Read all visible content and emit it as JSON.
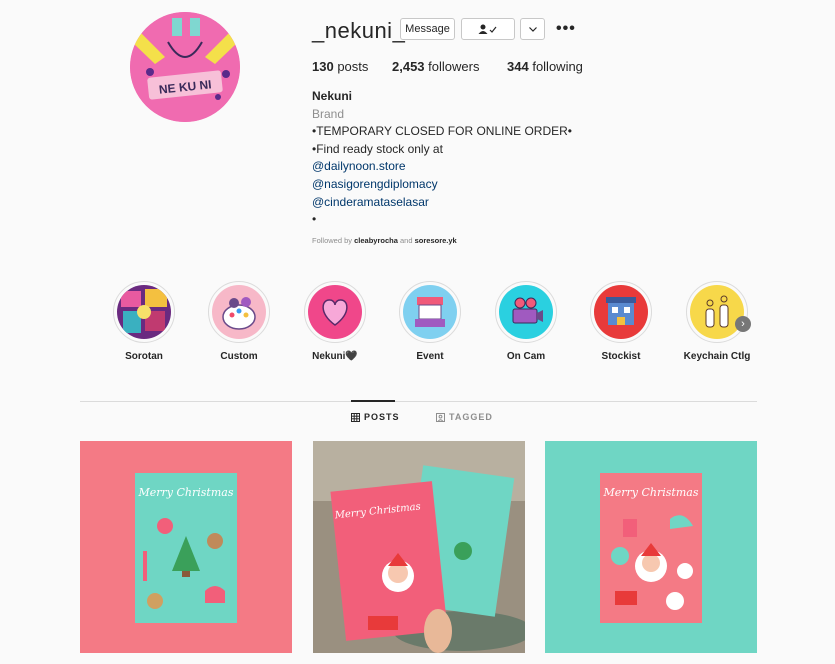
{
  "profile": {
    "username": "_nekuni_",
    "avatar_text": "NE KU NI",
    "buttons": {
      "message": "Message",
      "follow_icon": "person-check-icon",
      "dropdown_icon": "chevron-down-icon",
      "more": "•••"
    },
    "stats": {
      "posts_count": "130",
      "posts_label": "posts",
      "followers_count": "2,453",
      "followers_label": "followers",
      "following_count": "344",
      "following_label": "following"
    },
    "bio": {
      "name": "Nekuni",
      "category": "Brand",
      "lines": [
        "•TEMPORARY CLOSED FOR ONLINE ORDER•",
        "•Find ready stock only at"
      ],
      "mentions": [
        "@dailynoon.store",
        "@nasigorengdiplomacy",
        "@cinderamataselasar"
      ],
      "last_line": "•"
    },
    "followed_by": {
      "prefix": "Followed by",
      "user1": "cleabyrocha",
      "joiner": "and",
      "user2": "soresore.yk"
    }
  },
  "highlights": [
    {
      "label": "Sorotan",
      "icon": "collage-icon",
      "color": "#8a3aa0"
    },
    {
      "label": "Custom",
      "icon": "artist-palette-icon",
      "color": "#f7b8c8"
    },
    {
      "label": "Nekuni🖤",
      "icon": "heart-icon",
      "color": "#f0478a"
    },
    {
      "label": "Event",
      "icon": "booth-stall-icon",
      "color": "#7fd0f0"
    },
    {
      "label": "On Cam",
      "icon": "video-camera-icon",
      "color": "#2ad0e0"
    },
    {
      "label": "Stockist",
      "icon": "store-building-icon",
      "color": "#e83a3a"
    },
    {
      "label": "Keychain Ctlg",
      "icon": "keychain-bottles-icon",
      "color": "#f7d84a"
    }
  ],
  "tabs": {
    "posts": "POSTS",
    "tagged": "TAGGED"
  },
  "posts": [
    {
      "caption": "Merry Christmas",
      "bg": "#f47a85",
      "card": "#6fd6c4"
    },
    {
      "caption": "Merry Christmas",
      "bg": "#8a8070",
      "card": "#f25f7a"
    },
    {
      "caption": "Merry Christmas",
      "bg": "#6fd6c4",
      "card": "#f47a85"
    }
  ]
}
